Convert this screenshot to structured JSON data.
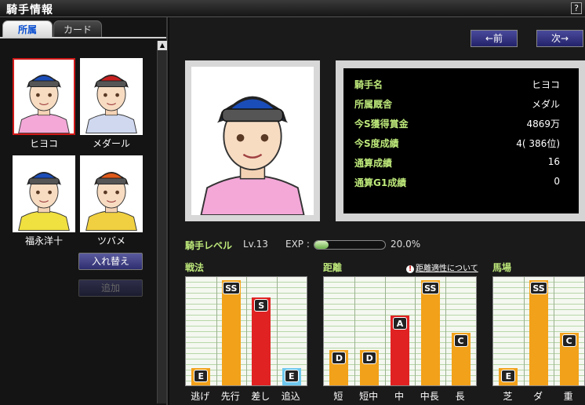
{
  "window": {
    "title": "騎手情報",
    "help_label": "?"
  },
  "tabs": [
    {
      "label": "所属"
    },
    {
      "label": "カード"
    }
  ],
  "roster": [
    {
      "name": "ヒヨコ",
      "helmet": "#1b4db8",
      "shirt": "#f3a8d8",
      "selected": true
    },
    {
      "name": "メダール",
      "helmet": "#c82020",
      "shirt": "#cfd8ef",
      "selected": false
    },
    {
      "name": "福永洋十",
      "helmet": "#1b4db8",
      "shirt": "#f0e040",
      "selected": false
    },
    {
      "name": "ツバメ",
      "helmet": "#e05a1a",
      "shirt": "#f0d040",
      "selected": false
    }
  ],
  "buttons": {
    "swap": "入れ替え",
    "add": "追加",
    "prev": "←前",
    "next": "次→"
  },
  "profile": {
    "rows": [
      {
        "label": "騎手名",
        "value": "ヒヨコ"
      },
      {
        "label": "所属厩舎",
        "value": "メダル"
      },
      {
        "label": "今S獲得賞金",
        "value": "4869万"
      },
      {
        "label": "今S度成績",
        "value": "4( 386位)"
      },
      {
        "label": "通算成績",
        "value": "16"
      },
      {
        "label": "通算G1成績",
        "value": "0"
      }
    ]
  },
  "level": {
    "label": "騎手レベル",
    "value": "Lv.13",
    "exp_label": "EXP :",
    "exp_percent": "20.0%",
    "exp_fraction": 0.2
  },
  "aptitude_link": "距離適性について",
  "colors": {
    "orange": "#f2a11a",
    "red": "#e02222",
    "light_blue": "#6ec8ee",
    "accent_green": "#bde87a"
  },
  "chart_data": [
    {
      "type": "bar",
      "title": "戦法",
      "categories": [
        "逃げ",
        "先行",
        "差し",
        "追込"
      ],
      "grades": [
        "E",
        "SS",
        "S",
        "E"
      ],
      "values": [
        1,
        6,
        5,
        1
      ],
      "colors": [
        "#f2a11a",
        "#f2a11a",
        "#e02222",
        "#6ec8ee"
      ],
      "ylim": [
        0,
        6
      ]
    },
    {
      "type": "bar",
      "title": "距離",
      "categories": [
        "短",
        "短中",
        "中",
        "中長",
        "長"
      ],
      "grades": [
        "D",
        "D",
        "A",
        "SS",
        "C"
      ],
      "values": [
        2,
        2,
        4,
        6,
        3
      ],
      "colors": [
        "#f2a11a",
        "#f2a11a",
        "#e02222",
        "#f2a11a",
        "#f2a11a"
      ],
      "ylim": [
        0,
        6
      ]
    },
    {
      "type": "bar",
      "title": "馬場",
      "categories": [
        "芝",
        "ダ",
        "重"
      ],
      "grades": [
        "E",
        "SS",
        "C"
      ],
      "values": [
        1,
        6,
        3
      ],
      "colors": [
        "#f2a11a",
        "#f2a11a",
        "#f2a11a"
      ],
      "ylim": [
        0,
        6
      ]
    }
  ]
}
